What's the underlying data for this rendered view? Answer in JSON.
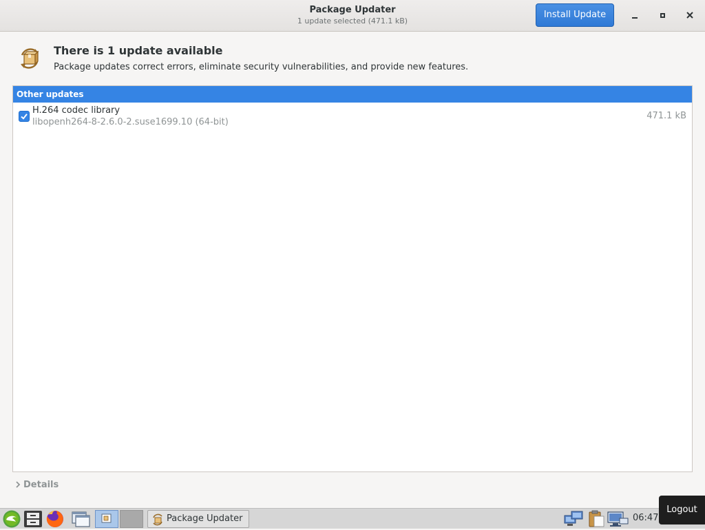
{
  "header": {
    "title": "Package Updater",
    "subtitle": "1 update selected (471.1 kB)",
    "install_button": "Install Update"
  },
  "info": {
    "heading": "There is 1 update available",
    "description": "Package updates correct errors, eliminate security vulnerabilities, and provide new features."
  },
  "updates": {
    "section_title": "Other updates",
    "items": [
      {
        "name": "H.264 codec library",
        "version": "libopenh264-8-2.6.0-2.suse1699.10 (64-bit)",
        "size": "471.1 kB",
        "checked": true
      }
    ]
  },
  "details_label": "Details",
  "taskbar": {
    "task_label": "Package Updater",
    "clock": "06:47"
  },
  "tooltip": "Logout",
  "colors": {
    "accent": "#3584e4",
    "button": "#2f79d6",
    "taskbar": "#d6d6d6"
  }
}
